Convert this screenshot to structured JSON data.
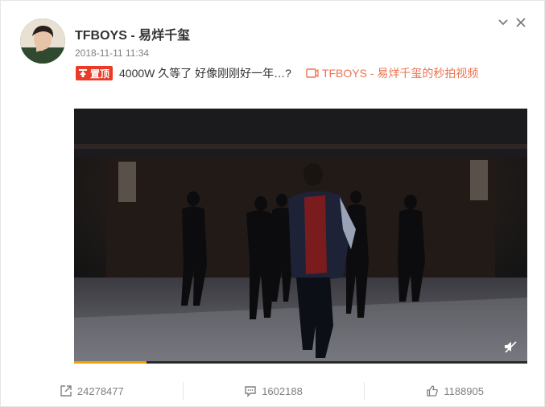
{
  "post": {
    "author": "TFBOYS - 易烊千玺",
    "timestamp": "2018-11-11 11:34",
    "pinned_label": "置顶",
    "text": "4000W 久等了 好像刚刚好一年…?",
    "video_link_text": "TFBOYS - 易烊千玺的秒拍视频"
  },
  "video": {
    "progress": 0.16
  },
  "actions": {
    "forward_count": "24278477",
    "comment_count": "1602188",
    "like_count": "1188905"
  },
  "icons": {
    "expand": "chevron-down-icon",
    "close": "close-icon",
    "pin": "pin-icon",
    "video": "video-icon",
    "mute": "mute-icon",
    "forward": "forward-icon",
    "comment": "comment-icon",
    "like": "thumbs-up-icon"
  },
  "colors": {
    "pinned_badge": "#eb3b26",
    "link": "#eb7350",
    "progress": "#f0a000"
  }
}
